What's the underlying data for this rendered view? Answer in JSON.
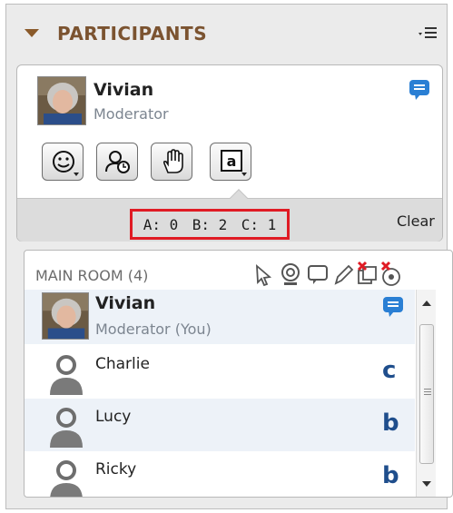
{
  "header": {
    "title": "PARTICIPANTS"
  },
  "card": {
    "name": "Vivian",
    "role": "Moderator",
    "counts": {
      "a": "A: 0",
      "b": "B: 2",
      "c": "C: 1"
    },
    "clear_label": "Clear"
  },
  "room": {
    "title": "MAIN ROOM (4)",
    "me": {
      "name": "Vivian",
      "role": "Moderator (You)"
    },
    "participants": [
      {
        "name": "Charlie",
        "answer": "c"
      },
      {
        "name": "Lucy",
        "answer": "b"
      },
      {
        "name": "Ricky",
        "answer": "b"
      }
    ]
  },
  "colors": {
    "accent": "#7b5330",
    "highlight": "#e01b24",
    "answer": "#1f4e8c",
    "chat": "#2a7fd4"
  }
}
